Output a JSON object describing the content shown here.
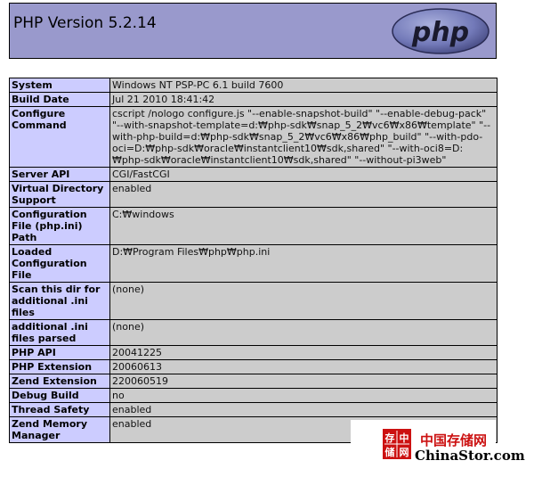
{
  "header": {
    "title": "PHP Version 5.2.14",
    "logo_text": "php"
  },
  "rows": [
    {
      "label": "System",
      "value": "Windows NT PSP-PC 6.1 build 7600"
    },
    {
      "label": "Build Date",
      "value": "Jul 21 2010 18:41:42"
    },
    {
      "label": "Configure Command",
      "value": "cscript /nologo configure.js \"--enable-snapshot-build\" \"--enable-debug-pack\" \"--with-snapshot-template=d:₩php-sdk₩snap_5_2₩vc6₩x86₩template\" \"--with-php-build=d:₩php-sdk₩snap_5_2₩vc6₩x86₩php_build\" \"--with-pdo-oci=D:₩php-sdk₩oracle₩instantclient10₩sdk,shared\" \"--with-oci8=D:₩php-sdk₩oracle₩instantclient10₩sdk,shared\" \"--without-pi3web\""
    },
    {
      "label": "Server API",
      "value": "CGI/FastCGI"
    },
    {
      "label": "Virtual Directory Support",
      "value": "enabled"
    },
    {
      "label": "Configuration File (php.ini) Path",
      "value": "C:₩windows"
    },
    {
      "label": "Loaded Configuration File",
      "value": "D:₩Program Files₩php₩php.ini"
    },
    {
      "label": "Scan this dir for additional .ini files",
      "value": "(none)"
    },
    {
      "label": "additional .ini files parsed",
      "value": "(none)"
    },
    {
      "label": "PHP API",
      "value": "20041225"
    },
    {
      "label": "PHP Extension",
      "value": "20060613"
    },
    {
      "label": "Zend Extension",
      "value": "220060519"
    },
    {
      "label": "Debug Build",
      "value": "no"
    },
    {
      "label": "Thread Safety",
      "value": "enabled"
    },
    {
      "label": "Zend Memory Manager",
      "value": "enabled"
    }
  ],
  "watermark": {
    "seal_chars": [
      "存",
      "中",
      "储",
      "网"
    ],
    "cn_text": "中国存储网",
    "en_text": "ChinaStor.com"
  },
  "colors": {
    "header_bg": "#9999cc",
    "label_bg": "#ccccff",
    "value_bg": "#cccccc",
    "watermark_red": "#cc1111"
  }
}
